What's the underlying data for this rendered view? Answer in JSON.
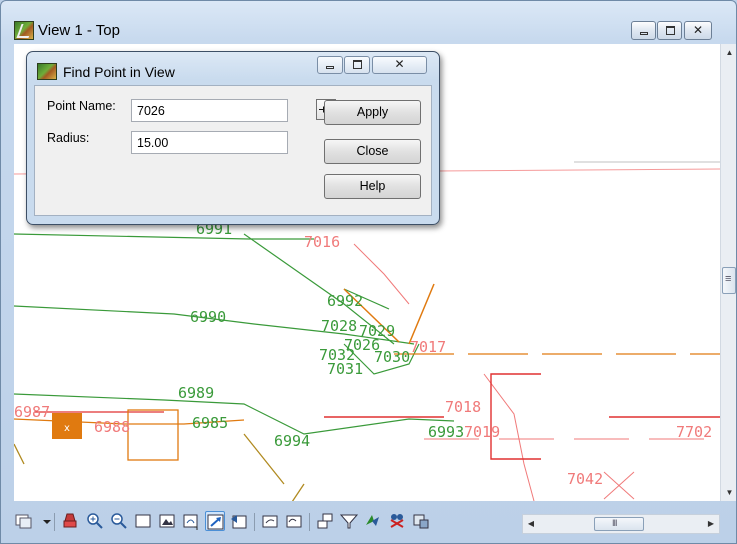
{
  "window": {
    "title": "View 1 - Top",
    "minimize_icon": "minimize-icon",
    "maximize_icon": "maximize-icon",
    "close_icon": "close-icon"
  },
  "dialog": {
    "title": "Find Point in View",
    "point_name_label": "Point Name:",
    "point_name_value": "7026",
    "radius_label": "Radius:",
    "radius_value": "15.00",
    "pick_icon": "crosshair-icon",
    "apply_label": "Apply",
    "close_label": "Close",
    "help_label": "Help"
  },
  "drawing": {
    "colors": {
      "green": "#3a9a3a",
      "pink": "#f07a7a",
      "red": "#e03030",
      "orange": "#e07a10",
      "olive": "#b08a20"
    },
    "green_labels": [
      "6991",
      "6990",
      "6992",
      "7028",
      "7029",
      "7026",
      "7032",
      "7030",
      "7031",
      "6989",
      "6985",
      "6994",
      "6993"
    ],
    "pink_labels": [
      "7016",
      "7017",
      "7018",
      "7019",
      "7042",
      "7702",
      "6988",
      "6987"
    ]
  },
  "toolbar": {
    "tools": [
      "view-attributes-icon",
      "update-view-icon",
      "zoom-in-icon",
      "zoom-out-icon",
      "window-area-icon",
      "fit-view-icon",
      "rotate-view-icon",
      "pan-view-icon",
      "view-previous-icon",
      "view-next-icon",
      "copy-view-icon",
      "clip-volume-icon",
      "camera-icon",
      "change-view-display-icon",
      "view-toggles-icon"
    ]
  }
}
